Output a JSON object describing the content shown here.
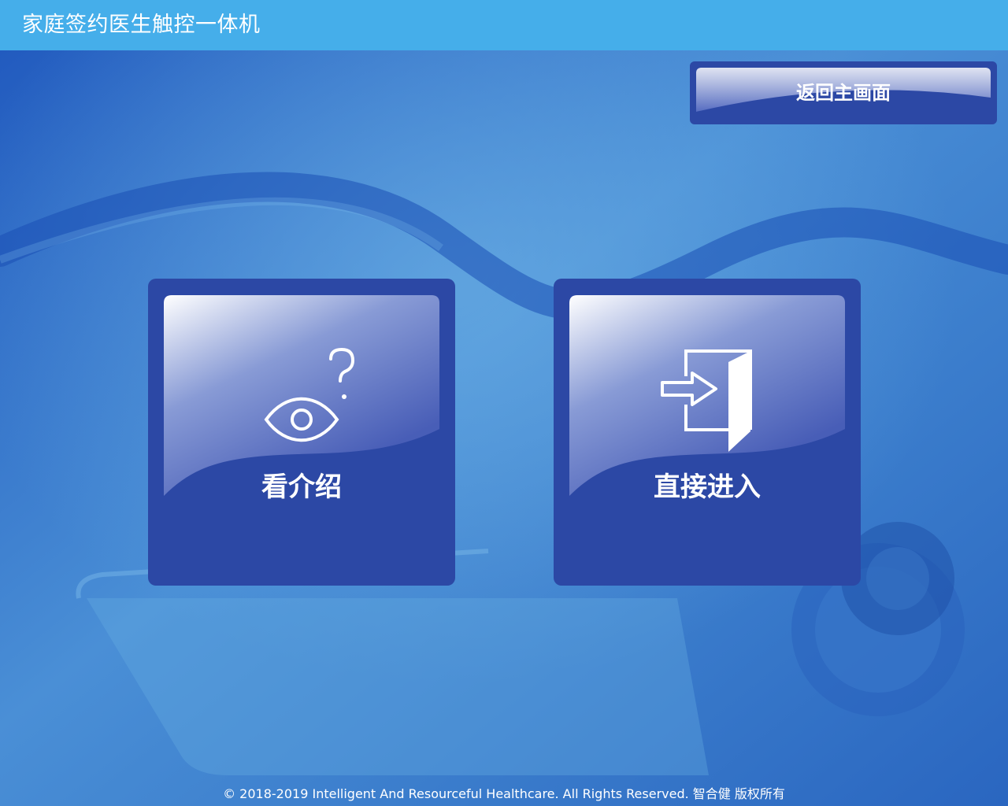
{
  "header": {
    "title": "家庭签约医生触控一体机"
  },
  "toolbar": {
    "back_label": "返回主画面"
  },
  "tiles": [
    {
      "label": "看介绍",
      "icon": "eye-question-icon"
    },
    {
      "label": "直接进入",
      "icon": "enter-door-icon"
    }
  ],
  "footer": {
    "copyright": "© 2018-2019 Intelligent And Resourceful Healthcare. All Rights Reserved. 智合健 版权所有"
  },
  "colors": {
    "topbar": "#45aeea",
    "tile": "#2c48a5",
    "background": "#2a6cc4"
  }
}
